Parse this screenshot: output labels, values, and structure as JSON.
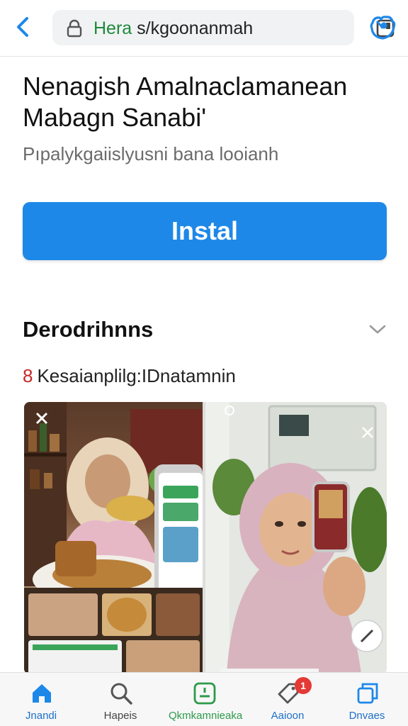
{
  "browser": {
    "url_green": "Hera",
    "url_rest": " s/kgoonanmah"
  },
  "app": {
    "title": "Nenagish Amalnaclamanean Mabagn Sanabi'",
    "subtitle": "Pıpalykgaiislyusni bana looianh",
    "install_label": "Instal"
  },
  "details": {
    "section_title": "Derodrihnns",
    "rating_number": "8",
    "rating_text": "Kesaianplilg:IDnatamnin"
  },
  "bottom_nav": {
    "items": [
      {
        "label": "Jnandi",
        "icon": "home-icon"
      },
      {
        "label": "Hapeis",
        "icon": "search-icon"
      },
      {
        "label": "Qkmkamnieaka",
        "icon": "apps-icon"
      },
      {
        "label": "Aaioon",
        "icon": "tag-icon",
        "badge": "1"
      },
      {
        "label": "Dnvaes",
        "icon": "library-icon"
      }
    ]
  },
  "colors": {
    "accent": "#1e88e8",
    "url_green": "#1e8a3c",
    "rating_red": "#c62828",
    "nav_active": "#1e88e8",
    "nav_green": "#2e9a4a",
    "badge_red": "#e53935"
  }
}
